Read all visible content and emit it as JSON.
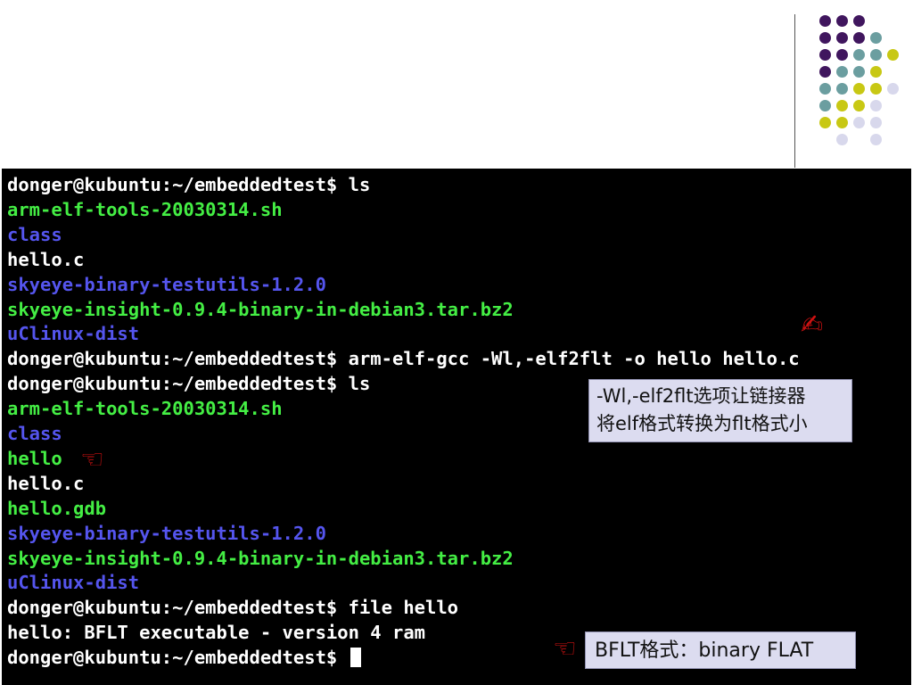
{
  "decor": {
    "dot_colors": {
      "purple": "#40165e",
      "teal": "#6b9ea0",
      "yellow": "#c8c814",
      "lavender": "#d8d8ec"
    },
    "dot_grid": [
      [
        "",
        "purple",
        "purple",
        "purple",
        ""
      ],
      [
        "",
        "purple",
        "purple",
        "purple",
        "teal"
      ],
      [
        "",
        "purple",
        "purple",
        "teal",
        "teal",
        "yellow"
      ],
      [
        "",
        "purple",
        "teal",
        "teal",
        "yellow",
        ""
      ],
      [
        "",
        "teal",
        "teal",
        "yellow",
        "yellow",
        "lavender"
      ],
      [
        "",
        "teal",
        "yellow",
        "yellow",
        "lavender",
        ""
      ],
      [
        "",
        "yellow",
        "yellow",
        "lavender",
        "lavender",
        ""
      ],
      [
        "",
        "",
        "lavender",
        "",
        "lavender",
        ""
      ]
    ]
  },
  "terminal": {
    "colors": {
      "white": "#ffffff",
      "green": "#44ee44",
      "blue": "#5555ee"
    },
    "lines": [
      {
        "text": "donger@kubuntu:~/embeddedtest$ ls",
        "color": "white"
      },
      {
        "text": "arm-elf-tools-20030314.sh",
        "color": "green"
      },
      {
        "text": "class",
        "color": "blue"
      },
      {
        "text": "hello.c",
        "color": "white"
      },
      {
        "text": "skyeye-binary-testutils-1.2.0",
        "color": "blue"
      },
      {
        "text": "skyeye-insight-0.9.4-binary-in-debian3.tar.bz2",
        "color": "green"
      },
      {
        "text": "uClinux-dist",
        "color": "blue"
      },
      {
        "text": "donger@kubuntu:~/embeddedtest$ arm-elf-gcc -Wl,-elf2flt -o hello hello.c",
        "color": "white"
      },
      {
        "text": "donger@kubuntu:~/embeddedtest$ ls",
        "color": "white"
      },
      {
        "text": "arm-elf-tools-20030314.sh",
        "color": "green"
      },
      {
        "text": "class",
        "color": "blue"
      },
      {
        "text": "hello",
        "color": "green"
      },
      {
        "text": "hello.c",
        "color": "white"
      },
      {
        "text": "hello.gdb",
        "color": "green"
      },
      {
        "text": "skyeye-binary-testutils-1.2.0",
        "color": "blue"
      },
      {
        "text": "skyeye-insight-0.9.4-binary-in-debian3.tar.bz2",
        "color": "green"
      },
      {
        "text": "uClinux-dist",
        "color": "blue"
      },
      {
        "text": "donger@kubuntu:~/embeddedtest$ file hello",
        "color": "white"
      },
      {
        "text": "hello: BFLT executable - version 4 ram",
        "color": "white"
      },
      {
        "text": "donger@kubuntu:~/embeddedtest$ ",
        "color": "white",
        "cursor": true
      }
    ]
  },
  "annotations": {
    "callout_elf2flt": {
      "line1": "-Wl,-elf2flt选项让链接器",
      "line2": "将elf格式转换为flt格式小"
    },
    "callout_bflt": "BFLT格式：binary FLAT",
    "hand_glyph": "☜",
    "hand_glyph_writing": "✍",
    "hand_icon_name": "pointing-hand-icon"
  }
}
